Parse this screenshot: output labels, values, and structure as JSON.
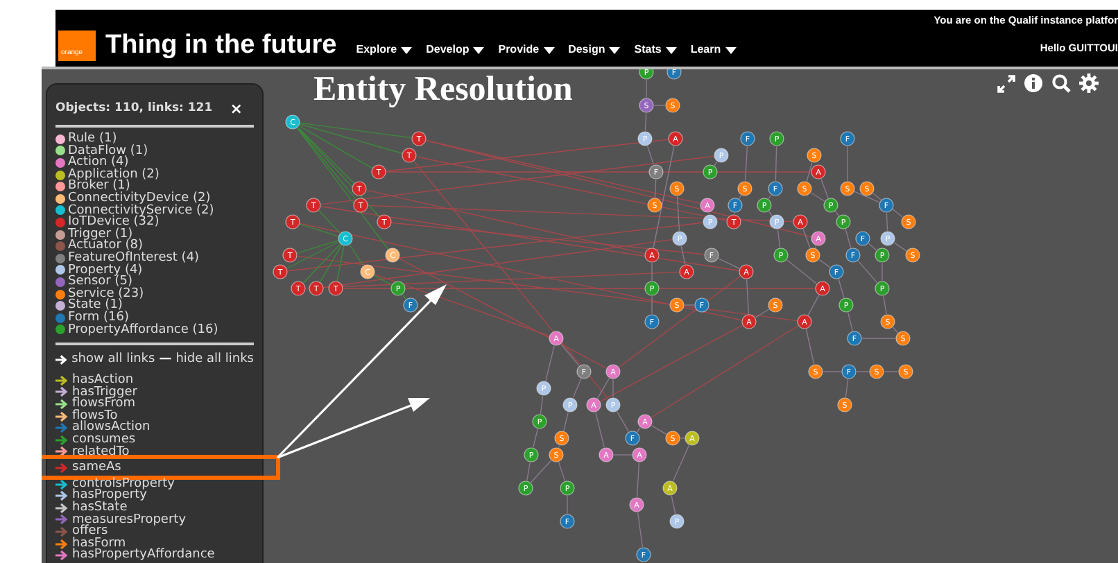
{
  "header": {
    "logo": "orange",
    "title": "Thing in the future",
    "menu": [
      "Explore",
      "Develop",
      "Provide",
      "Design",
      "Stats",
      "Learn"
    ],
    "instance_notice": "You are on the Qualif instance platfor",
    "greeting": "Hello GUITTOUI"
  },
  "canvas": {
    "title": "Entity Resolution"
  },
  "legend": {
    "summary": "Objects: 110, links: 121",
    "close": "×",
    "objects": [
      {
        "label": "Rule (1)",
        "color": "#f7b6d2"
      },
      {
        "label": "DataFlow (1)",
        "color": "#98df8a"
      },
      {
        "label": "Action (4)",
        "color": "#e377c2"
      },
      {
        "label": "Application (2)",
        "color": "#bcbd22"
      },
      {
        "label": "Broker (1)",
        "color": "#ff9896"
      },
      {
        "label": "ConnectivityDevice (2)",
        "color": "#ffbb78"
      },
      {
        "label": "ConnectivityService (2)",
        "color": "#17becf"
      },
      {
        "label": "IoTDevice (32)",
        "color": "#d62728"
      },
      {
        "label": "Trigger (1)",
        "color": "#c49c94"
      },
      {
        "label": "Actuator (8)",
        "color": "#8c564b"
      },
      {
        "label": "FeatureOfInterest (4)",
        "color": "#7f7f7f"
      },
      {
        "label": "Property (4)",
        "color": "#aec7e8"
      },
      {
        "label": "Sensor (5)",
        "color": "#9467bd"
      },
      {
        "label": "Service (23)",
        "color": "#ff7f0e"
      },
      {
        "label": "State (1)",
        "color": "#c5b0d5"
      },
      {
        "label": "Form (16)",
        "color": "#1f77b4"
      },
      {
        "label": "PropertyAffordance (16)",
        "color": "#2ca02c"
      }
    ],
    "show_all": "show all links",
    "separator": "—",
    "hide_all": "hide all links",
    "links": [
      {
        "label": "hasAction",
        "color": "#bcbd22",
        "highlighted": false
      },
      {
        "label": "hasTrigger",
        "color": "#c5b0d5",
        "highlighted": false
      },
      {
        "label": "flowsFrom",
        "color": "#98df8a",
        "highlighted": false
      },
      {
        "label": "flowsTo",
        "color": "#ffbb78",
        "highlighted": false
      },
      {
        "label": "allowsAction",
        "color": "#1f77b4",
        "highlighted": false
      },
      {
        "label": "consumes",
        "color": "#2ca02c",
        "highlighted": false
      },
      {
        "label": "relatedTo",
        "color": "#ff9896",
        "highlighted": false
      },
      {
        "label": "sameAs",
        "color": "#d62728",
        "highlighted": true
      },
      {
        "label": "controlsProperty",
        "color": "#17becf",
        "highlighted": false
      },
      {
        "label": "hasProperty",
        "color": "#aec7e8",
        "highlighted": false
      },
      {
        "label": "hasState",
        "color": "#c7c7c7",
        "highlighted": false
      },
      {
        "label": "measuresProperty",
        "color": "#9467bd",
        "highlighted": false
      },
      {
        "label": "offers",
        "color": "#8c564b",
        "highlighted": false
      },
      {
        "label": "hasForm",
        "color": "#ff7f0e",
        "highlighted": false
      },
      {
        "label": "hasPropertyAffordance",
        "color": "#e377c2",
        "highlighted": false
      }
    ]
  },
  "graph": {
    "nodes": [
      {
        "label": "P",
        "color": "#2ca02c"
      },
      {
        "label": "F",
        "color": "#1f77b4"
      },
      {
        "label": "S",
        "color": "#9467bd"
      },
      {
        "label": "S",
        "color": "#ff7f0e"
      },
      {
        "label": "C",
        "color": "#17becf"
      },
      {
        "label": "T",
        "color": "#d62728"
      },
      {
        "label": "P",
        "color": "#aec7e8"
      },
      {
        "label": "A",
        "color": "#d62728"
      },
      {
        "label": "F",
        "color": "#1f77b4"
      },
      {
        "label": "P",
        "color": "#2ca02c"
      },
      {
        "label": "F",
        "color": "#1f77b4"
      },
      {
        "label": "T",
        "color": "#d62728"
      },
      {
        "label": "P",
        "color": "#aec7e8"
      },
      {
        "label": "S",
        "color": "#ff7f0e"
      },
      {
        "label": "T",
        "color": "#d62728"
      },
      {
        "label": "F",
        "color": "#7f7f7f"
      },
      {
        "label": "P",
        "color": "#2ca02c"
      },
      {
        "label": "A",
        "color": "#d62728"
      },
      {
        "label": "T",
        "color": "#d62728"
      },
      {
        "label": "S",
        "color": "#ff7f0e"
      },
      {
        "label": "S",
        "color": "#ff7f0e"
      },
      {
        "label": "F",
        "color": "#1f77b4"
      },
      {
        "label": "S",
        "color": "#ff7f0e"
      },
      {
        "label": "S",
        "color": "#ff7f0e"
      },
      {
        "label": "S",
        "color": "#ff7f0e"
      },
      {
        "label": "T",
        "color": "#d62728"
      },
      {
        "label": "T",
        "color": "#d62728"
      },
      {
        "label": "S",
        "color": "#ff7f0e"
      },
      {
        "label": "A",
        "color": "#e377c2"
      },
      {
        "label": "F",
        "color": "#1f77b4"
      },
      {
        "label": "P",
        "color": "#2ca02c"
      },
      {
        "label": "P",
        "color": "#2ca02c"
      },
      {
        "label": "F",
        "color": "#1f77b4"
      },
      {
        "label": "T",
        "color": "#d62728"
      },
      {
        "label": "T",
        "color": "#d62728"
      },
      {
        "label": "P",
        "color": "#aec7e8"
      },
      {
        "label": "T",
        "color": "#d62728"
      },
      {
        "label": "P",
        "color": "#aec7e8"
      },
      {
        "label": "A",
        "color": "#d62728"
      },
      {
        "label": "P",
        "color": "#2ca02c"
      },
      {
        "label": "S",
        "color": "#ff7f0e"
      },
      {
        "label": "C",
        "color": "#17becf"
      },
      {
        "label": "P",
        "color": "#aec7e8"
      },
      {
        "label": "A",
        "color": "#e377c2"
      },
      {
        "label": "F",
        "color": "#1f77b4"
      },
      {
        "label": "P",
        "color": "#aec7e8"
      },
      {
        "label": "T",
        "color": "#d62728"
      },
      {
        "label": "C",
        "color": "#ffbb78"
      },
      {
        "label": "A",
        "color": "#d62728"
      },
      {
        "label": "F",
        "color": "#7f7f7f"
      },
      {
        "label": "P",
        "color": "#2ca02c"
      },
      {
        "label": "S",
        "color": "#ff7f0e"
      },
      {
        "label": "F",
        "color": "#1f77b4"
      },
      {
        "label": "P",
        "color": "#2ca02c"
      },
      {
        "label": "S",
        "color": "#ff7f0e"
      },
      {
        "label": "T",
        "color": "#d62728"
      },
      {
        "label": "C",
        "color": "#ffbb78"
      },
      {
        "label": "A",
        "color": "#d62728"
      },
      {
        "label": "A",
        "color": "#d62728"
      },
      {
        "label": "F",
        "color": "#1f77b4"
      },
      {
        "label": "T",
        "color": "#d62728"
      },
      {
        "label": "T",
        "color": "#d62728"
      },
      {
        "label": "T",
        "color": "#d62728"
      },
      {
        "label": "P",
        "color": "#2ca02c"
      },
      {
        "label": "P",
        "color": "#2ca02c"
      },
      {
        "label": "A",
        "color": "#d62728"
      },
      {
        "label": "P",
        "color": "#2ca02c"
      },
      {
        "label": "F",
        "color": "#1f77b4"
      },
      {
        "label": "S",
        "color": "#ff7f0e"
      },
      {
        "label": "F",
        "color": "#1f77b4"
      },
      {
        "label": "S",
        "color": "#ff7f0e"
      },
      {
        "label": "P",
        "color": "#2ca02c"
      },
      {
        "label": "F",
        "color": "#1f77b4"
      },
      {
        "label": "A",
        "color": "#d62728"
      },
      {
        "label": "A",
        "color": "#d62728"
      },
      {
        "label": "S",
        "color": "#ff7f0e"
      },
      {
        "label": "A",
        "color": "#e377c2"
      },
      {
        "label": "F",
        "color": "#1f77b4"
      },
      {
        "label": "S",
        "color": "#ff7f0e"
      },
      {
        "label": "F",
        "color": "#7f7f7f"
      },
      {
        "label": "A",
        "color": "#e377c2"
      },
      {
        "label": "S",
        "color": "#ff7f0e"
      },
      {
        "label": "F",
        "color": "#1f77b4"
      },
      {
        "label": "S",
        "color": "#ff7f0e"
      },
      {
        "label": "S",
        "color": "#ff7f0e"
      },
      {
        "label": "P",
        "color": "#aec7e8"
      },
      {
        "label": "P",
        "color": "#aec7e8"
      },
      {
        "label": "A",
        "color": "#e377c2"
      },
      {
        "label": "P",
        "color": "#aec7e8"
      },
      {
        "label": "S",
        "color": "#ff7f0e"
      },
      {
        "label": "P",
        "color": "#2ca02c"
      },
      {
        "label": "A",
        "color": "#e377c2"
      },
      {
        "label": "S",
        "color": "#ff7f0e"
      },
      {
        "label": "F",
        "color": "#1f77b4"
      },
      {
        "label": "S",
        "color": "#ff7f0e"
      },
      {
        "label": "A",
        "color": "#bcbd22"
      },
      {
        "label": "P",
        "color": "#2ca02c"
      },
      {
        "label": "S",
        "color": "#ff7f0e"
      },
      {
        "label": "A",
        "color": "#e377c2"
      },
      {
        "label": "A",
        "color": "#e377c2"
      },
      {
        "label": "P",
        "color": "#2ca02c"
      },
      {
        "label": "P",
        "color": "#2ca02c"
      },
      {
        "label": "A",
        "color": "#bcbd22"
      },
      {
        "label": "A",
        "color": "#e377c2"
      },
      {
        "label": "F",
        "color": "#1f77b4"
      },
      {
        "label": "P",
        "color": "#aec7e8"
      },
      {
        "label": "F",
        "color": "#1f77b4"
      }
    ]
  }
}
